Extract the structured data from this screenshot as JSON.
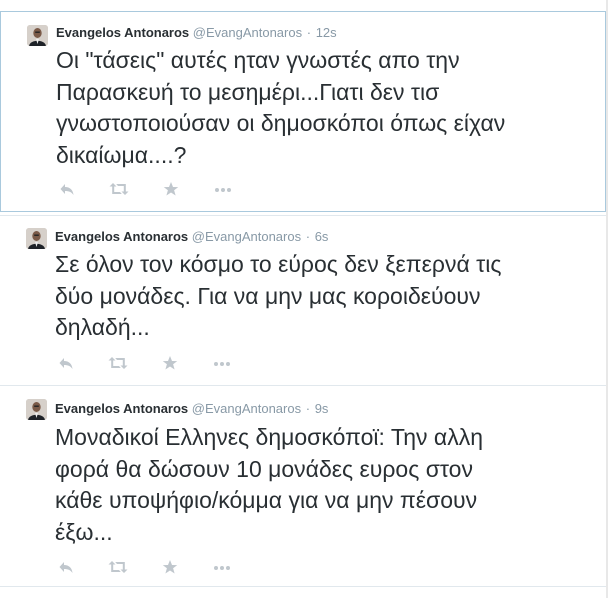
{
  "icons": {
    "reply": "reply-icon",
    "retweet": "retweet-icon",
    "favorite": "favorite-star-icon",
    "more": "more-options-icon"
  },
  "colors": {
    "text": "#292f33",
    "meta": "#8899a6",
    "icon": "#c0c7cd",
    "highlight_border": "#a9c9dd",
    "divider": "#e1e8ed"
  },
  "tweets": [
    {
      "fullname": "Evangelos Antonaros",
      "username": "@EvangAntonaros",
      "dot": "·",
      "time": "12s",
      "lines": [
        "Οι \"τάσεις\" αυτές ηταν γνωστές απο την",
        "Παρασκευή το μεσημέρι...Γιατι δεν τισ",
        "γνωστοποιούσαν οι δημοσκόποι όπως είχαν",
        "δικαίωμα....?"
      ]
    },
    {
      "fullname": "Evangelos Antonaros",
      "username": "@EvangAntonaros",
      "dot": "·",
      "time": "6s",
      "lines": [
        "Σε όλον τον κόσμο το εύρος δεν ξεπερνά τις",
        "δύο μονάδες. Για να μην μας κοροιδεύουν",
        "δηλαδή..."
      ]
    },
    {
      "fullname": "Evangelos Antonaros",
      "username": "@EvangAntonaros",
      "dot": "·",
      "time": "9s",
      "lines": [
        "Μοναδικοί Ελληνες δημοσκόποϊ: Την αλλη",
        "φορά θα δώσουν 10 μονάδες ευρος στον",
        "κάθε υποψήφιο/κόμμα για να μην πέσουν",
        "έξω..."
      ]
    }
  ]
}
